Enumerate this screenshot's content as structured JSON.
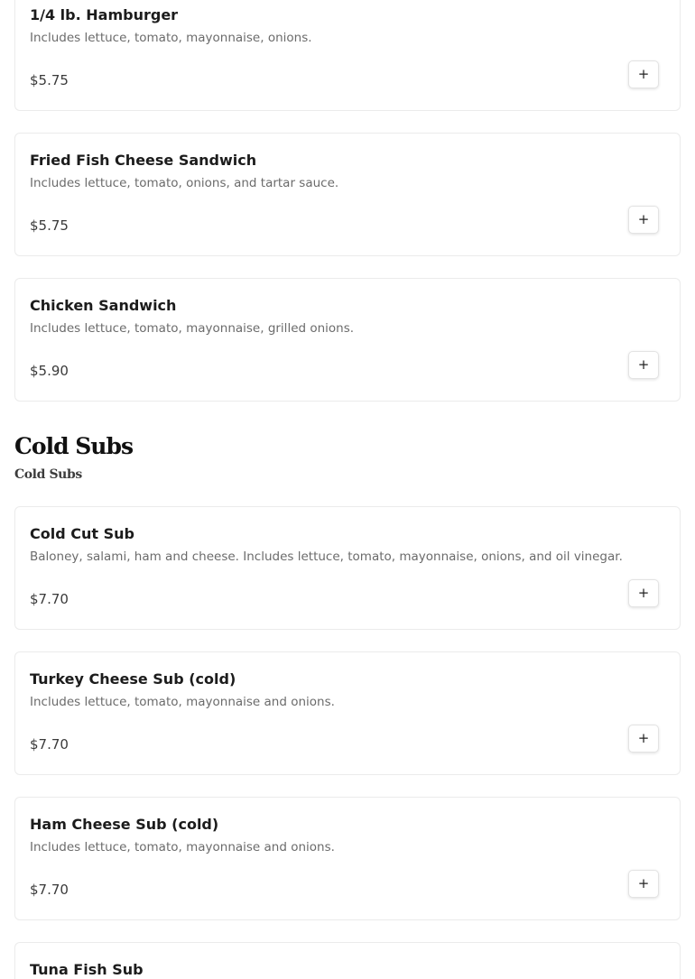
{
  "sections": [
    {
      "items": [
        {
          "name": "1/4 lb. Hamburger",
          "description": "Includes lettuce, tomato, mayonnaise, onions.",
          "price": "$5.75",
          "add_icon": "plus-icon"
        },
        {
          "name": "Fried Fish Cheese Sandwich",
          "description": "Includes lettuce, tomato, onions, and tartar sauce.",
          "price": "$5.75",
          "add_icon": "plus-icon"
        },
        {
          "name": "Chicken Sandwich",
          "description": "Includes lettuce, tomato, mayonnaise, grilled onions.",
          "price": "$5.90",
          "add_icon": "plus-icon"
        }
      ]
    },
    {
      "title": "Cold Subs",
      "subtitle": "Cold Subs",
      "items": [
        {
          "name": "Cold Cut Sub",
          "description": "Baloney, salami, ham and cheese. Includes lettuce, tomato, mayonnaise, onions, and oil vinegar.",
          "price": "$7.70",
          "add_icon": "plus-icon"
        },
        {
          "name": "Turkey Cheese Sub (cold)",
          "description": "Includes lettuce, tomato, mayonnaise and onions.",
          "price": "$7.70",
          "add_icon": "plus-icon"
        },
        {
          "name": "Ham Cheese Sub (cold)",
          "description": "Includes lettuce, tomato, mayonnaise and onions.",
          "price": "$7.70",
          "add_icon": "plus-icon"
        },
        {
          "name": "Tuna Fish Sub"
        }
      ]
    }
  ],
  "add_button_symbol": "+"
}
